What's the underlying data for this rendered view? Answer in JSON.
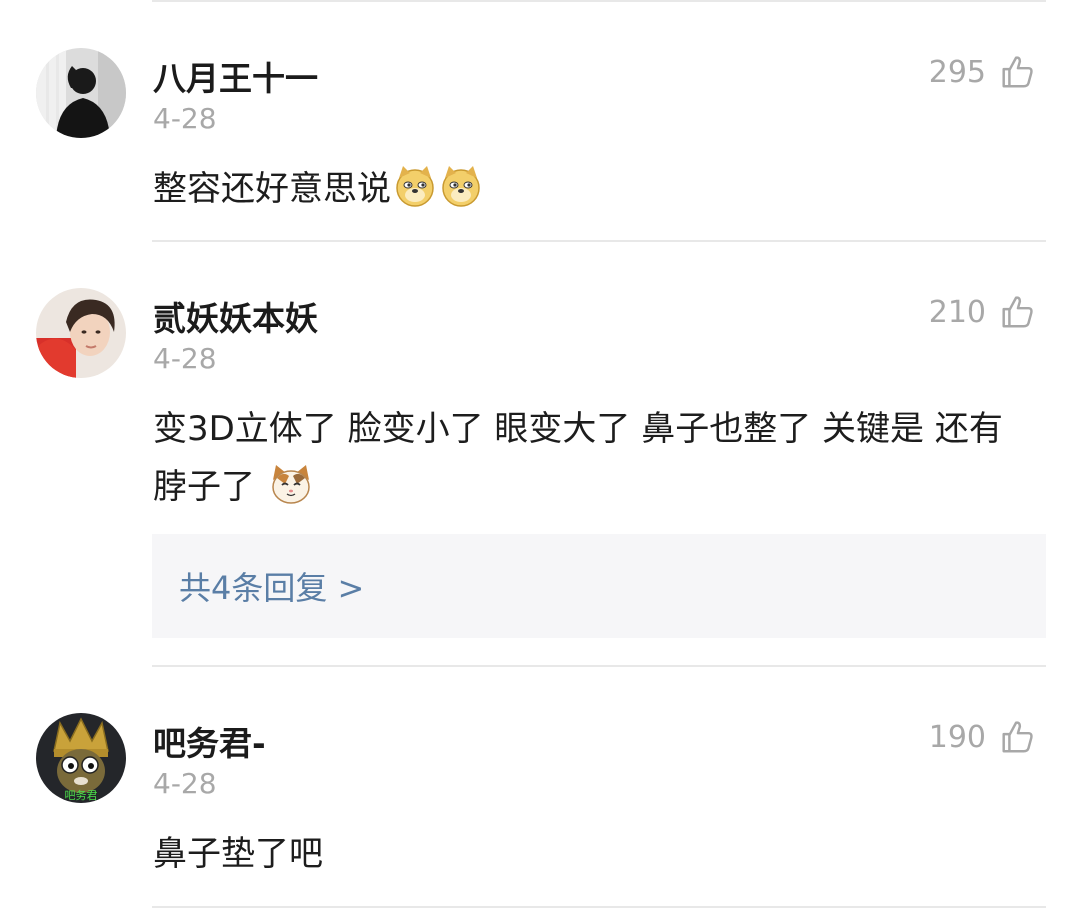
{
  "comments": [
    {
      "username": "八月王十一",
      "date": "4-28",
      "likes": "295",
      "text": "整容还好意思说",
      "emojis": [
        "doge-emoji",
        "doge-emoji"
      ],
      "avatar": "dark-silhouette"
    },
    {
      "username": "贰妖妖本妖",
      "date": "4-28",
      "likes": "210",
      "text": "变3D立体了  脸变小了 眼变大了 鼻子也整了  关键是 还有脖子了",
      "emojis": [
        "cat-emoji"
      ],
      "avatar": "portrait-red",
      "reply_link": "共4条回复 >"
    },
    {
      "username": "吧务君-",
      "date": "4-28",
      "likes": "190",
      "text": "鼻子垫了吧",
      "emojis": [],
      "avatar": "game-character",
      "avatar_caption": "吧务君"
    }
  ],
  "colors": {
    "divider": "#e8e8e8",
    "muted_text": "#a8a8a8",
    "reply_link": "#5a7ea6",
    "reply_bg": "#f6f6f8"
  }
}
